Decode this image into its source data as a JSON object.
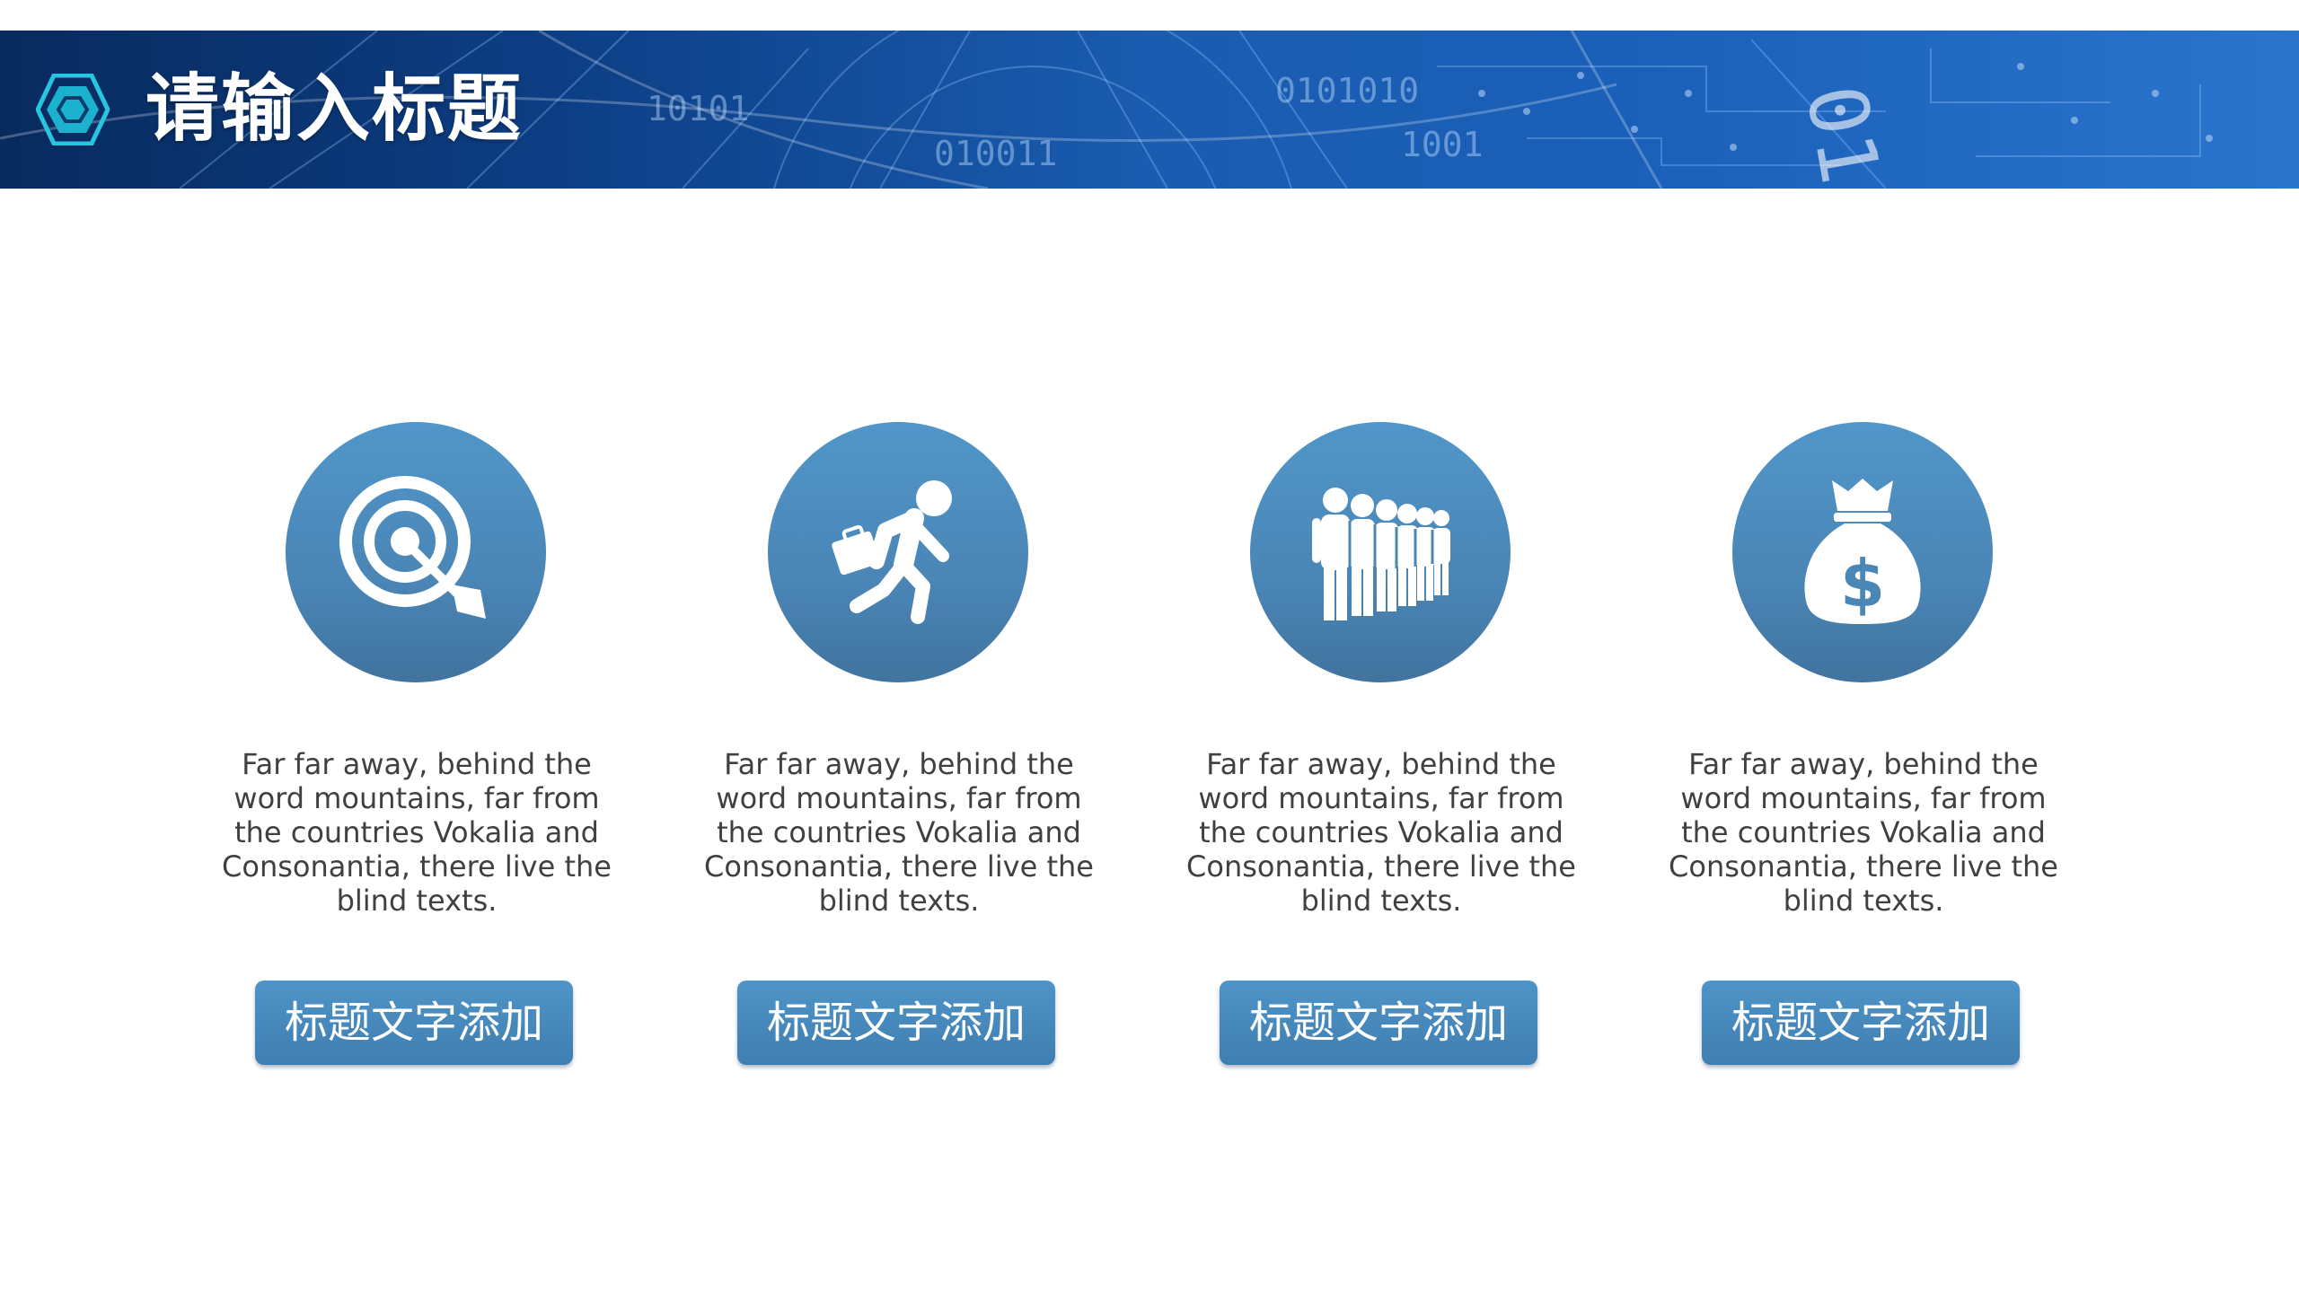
{
  "header": {
    "title": "请输入标题",
    "icon": "hexagon-icon",
    "accent_color": "#27c6e0"
  },
  "colors": {
    "circle": "#4a86b6",
    "button": "#4788bb",
    "text": "#404040"
  },
  "cards": [
    {
      "icon": "target-arrow-icon",
      "description": "Far far away, behind the word mountains, far from the countries Vokalia and Consonantia, there live the blind texts.",
      "button_label": "标题文字添加"
    },
    {
      "icon": "running-businessman-icon",
      "description": "Far far away, behind the word mountains, far from the countries Vokalia and Consonantia, there live the blind texts.",
      "button_label": "标题文字添加"
    },
    {
      "icon": "people-queue-icon",
      "description": "Far far away, behind the word mountains, far from the countries Vokalia and Consonantia, there live the blind texts.",
      "button_label": "标题文字添加"
    },
    {
      "icon": "money-bag-icon",
      "description": "Far far away, behind the word mountains, far from the countries Vokalia and Consonantia, there live the blind texts.",
      "button_label": "标题文字添加"
    }
  ]
}
